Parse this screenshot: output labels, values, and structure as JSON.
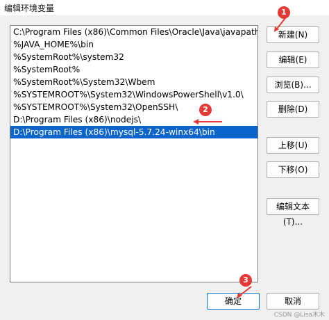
{
  "window": {
    "title": "编辑环境变量"
  },
  "paths": [
    "C:\\Program Files (x86)\\Common Files\\Oracle\\Java\\javapath",
    "%JAVA_HOME%\\bin",
    "%SystemRoot%\\system32",
    "%SystemRoot%",
    "%SystemRoot%\\System32\\Wbem",
    "%SYSTEMROOT%\\System32\\WindowsPowerShell\\v1.0\\",
    "%SYSTEMROOT%\\System32\\OpenSSH\\",
    "D:\\Program Files (x86)\\nodejs\\",
    "D:\\Program Files (x86)\\mysql-5.7.24-winx64\\bin"
  ],
  "selected_index": 8,
  "buttons": {
    "new": "新建(N)",
    "edit": "编辑(E)",
    "browse": "浏览(B)...",
    "delete": "删除(D)",
    "move_up": "上移(U)",
    "move_down": "下移(O)",
    "edit_text": "编辑文本(T)...",
    "ok": "确定",
    "cancel": "取消"
  },
  "annotations": {
    "badge_1": "1",
    "badge_2": "2",
    "badge_3": "3",
    "color": "#e53935"
  },
  "watermark": "CSDN @Lisa木木"
}
